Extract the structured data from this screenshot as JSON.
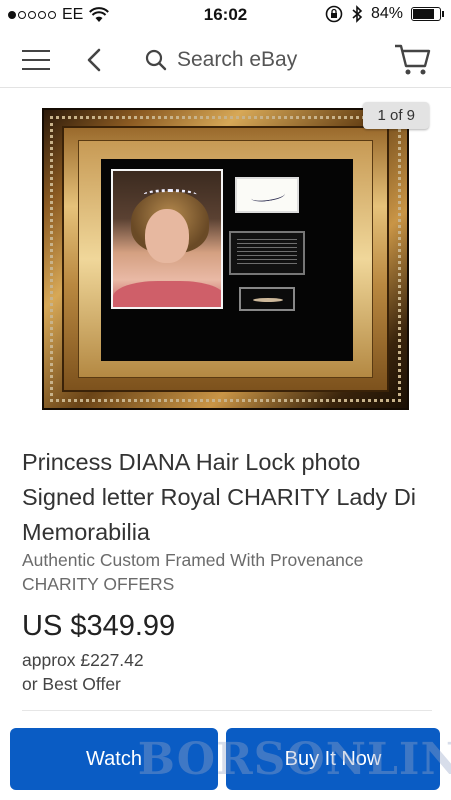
{
  "status_bar": {
    "carrier": "EE",
    "time": "16:02",
    "battery_percent": "84%",
    "battery_level": 0.84,
    "icons": [
      "signal-dots-icon",
      "wifi-icon",
      "rotation-lock-icon",
      "bluetooth-icon",
      "battery-icon"
    ]
  },
  "nav": {
    "search_placeholder": "Search eBay",
    "icons": [
      "hamburger-menu-icon",
      "back-chevron-icon",
      "search-icon",
      "cart-icon"
    ]
  },
  "image": {
    "counter": "1 of 9",
    "description_icon": "framed-memorabilia-photo"
  },
  "listing": {
    "title": "Princess DIANA Hair Lock photo Signed letter Royal CHARITY Lady Di Memorabilia",
    "subtitle": "Authentic Custom Framed With Provenance CHARITY OFFERS",
    "price": "US $349.99",
    "approx": "approx £227.42",
    "best_offer": "or Best Offer"
  },
  "actions": {
    "watch_label": "Watch",
    "buy_label": "Buy It Now"
  },
  "watermark": "BORSONLINE",
  "colors": {
    "primary_button": "#0a5cc4",
    "text_primary": "#333333",
    "text_secondary": "#6b6b6b"
  }
}
